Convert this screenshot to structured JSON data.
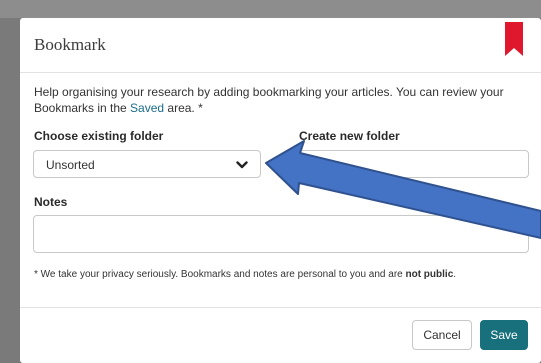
{
  "dialog": {
    "title": "Bookmark",
    "intro_text": "Help organising your research by adding bookmarking your articles. You can review your Bookmarks in the ",
    "intro_link": "Saved",
    "intro_suffix": " area. *"
  },
  "form": {
    "existing_folder_label": "Choose existing folder",
    "existing_folder_value": "Unsorted",
    "new_folder_label": "Create new folder",
    "new_folder_value": "",
    "notes_label": "Notes",
    "notes_value": ""
  },
  "privacy": {
    "text": "* We take your privacy seriously. Bookmarks and notes are personal to you and are ",
    "emphasis": "not public",
    "suffix": "."
  },
  "footer": {
    "cancel_label": "Cancel",
    "save_label": "Save"
  },
  "colors": {
    "accent": "#17707c",
    "ribbon": "#e0182d",
    "annotation_arrow": "#4472c4"
  },
  "icons": {
    "ribbon": "bookmark-ribbon-icon",
    "select_caret": "chevron-down-icon",
    "annotation": "arrow-annotation"
  }
}
